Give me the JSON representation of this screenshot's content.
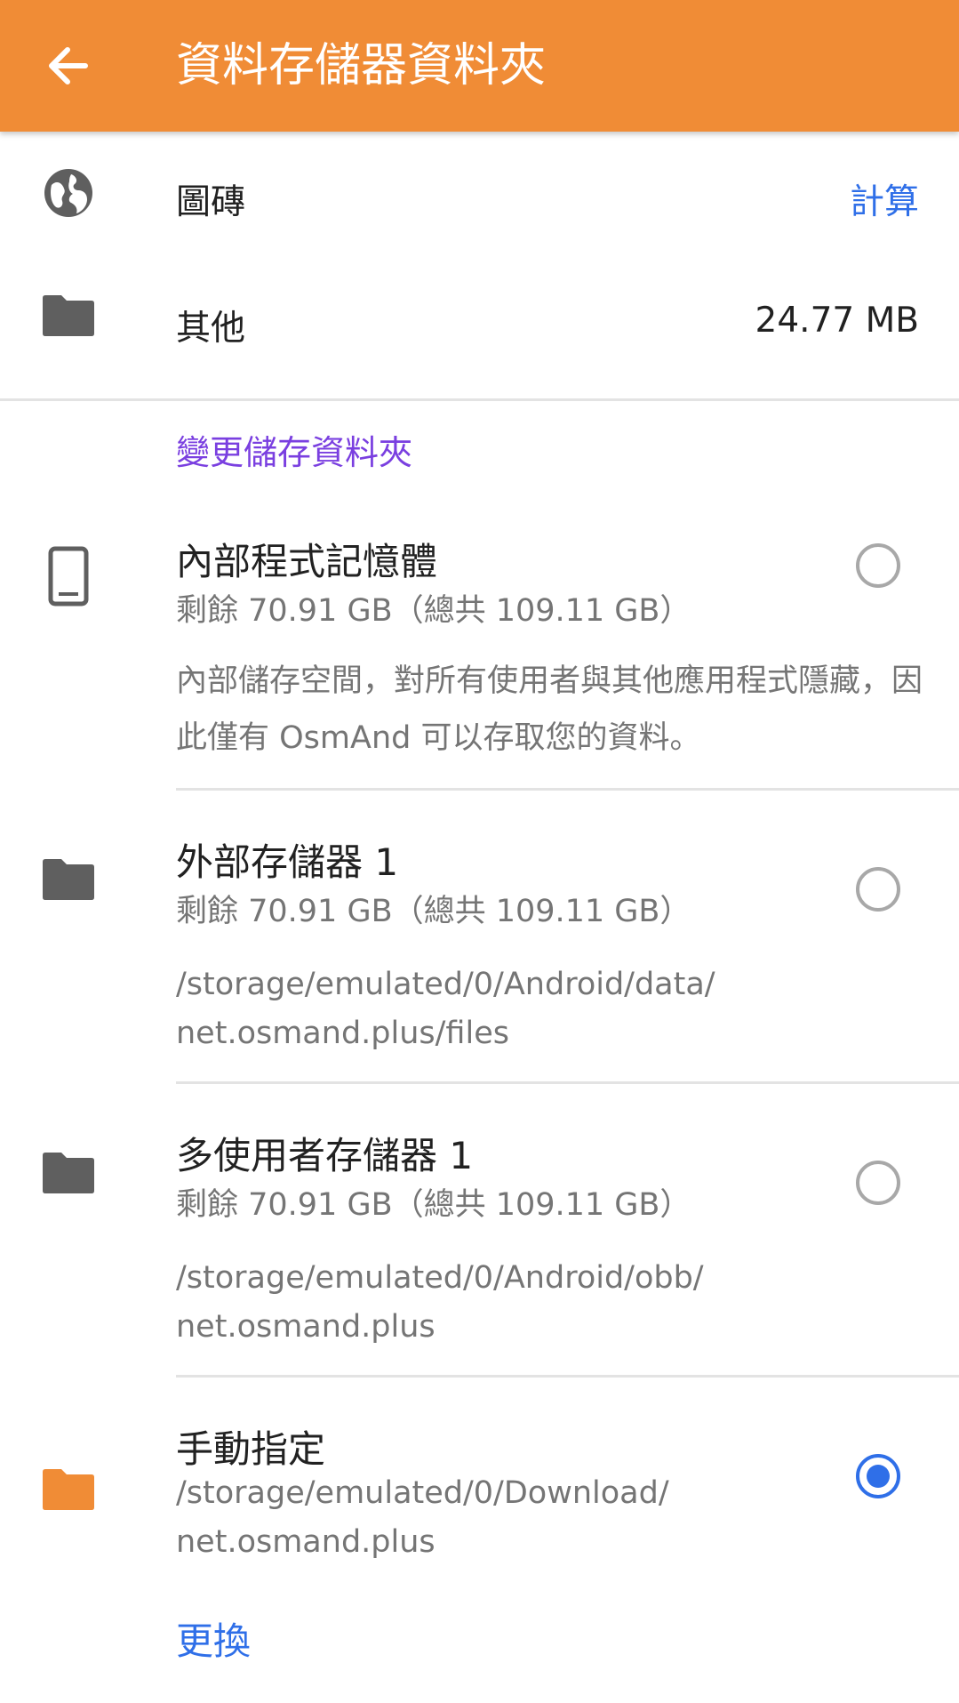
{
  "header": {
    "title": "資料存儲器資料夾",
    "back_icon": "arrow-left-icon"
  },
  "usage": {
    "tiles": {
      "label": "圖磚",
      "action": "計算",
      "icon": "globe-icon"
    },
    "other": {
      "label": "其他",
      "value": "24.77 MB",
      "icon": "folder-icon"
    }
  },
  "change_section": {
    "title": "變更儲存資料夾"
  },
  "options": [
    {
      "title": "內部程式記憶體",
      "subtitle": "剩餘 70.91 GB（總共 109.11 GB）",
      "description": "內部儲存空間，對所有使用者與其他應用程式隱藏，因此僅有 OsmAnd 可以存取您的資料。",
      "icon": "phone-icon",
      "selected": false
    },
    {
      "title": "外部存儲器 1",
      "subtitle": "剩餘 70.91 GB（總共 109.11 GB）",
      "path_line1": "/storage/emulated/0/Android/data/",
      "path_line2": "net.osmand.plus/files",
      "icon": "folder-icon",
      "selected": false
    },
    {
      "title": "多使用者存儲器 1",
      "subtitle": "剩餘 70.91 GB（總共 109.11 GB）",
      "path_line1": "/storage/emulated/0/Android/obb/",
      "path_line2": "net.osmand.plus",
      "icon": "folder-icon",
      "selected": false
    },
    {
      "title": "手動指定",
      "path_line1": "/storage/emulated/0/Download/",
      "path_line2": "net.osmand.plus",
      "icon": "folder-orange-icon",
      "selected": true,
      "action": "更換"
    }
  ],
  "colors": {
    "appbar": "#F08C36",
    "accent": "#2F6FE8",
    "section": "#7A3FE0",
    "selected_folder": "#F08C36"
  }
}
